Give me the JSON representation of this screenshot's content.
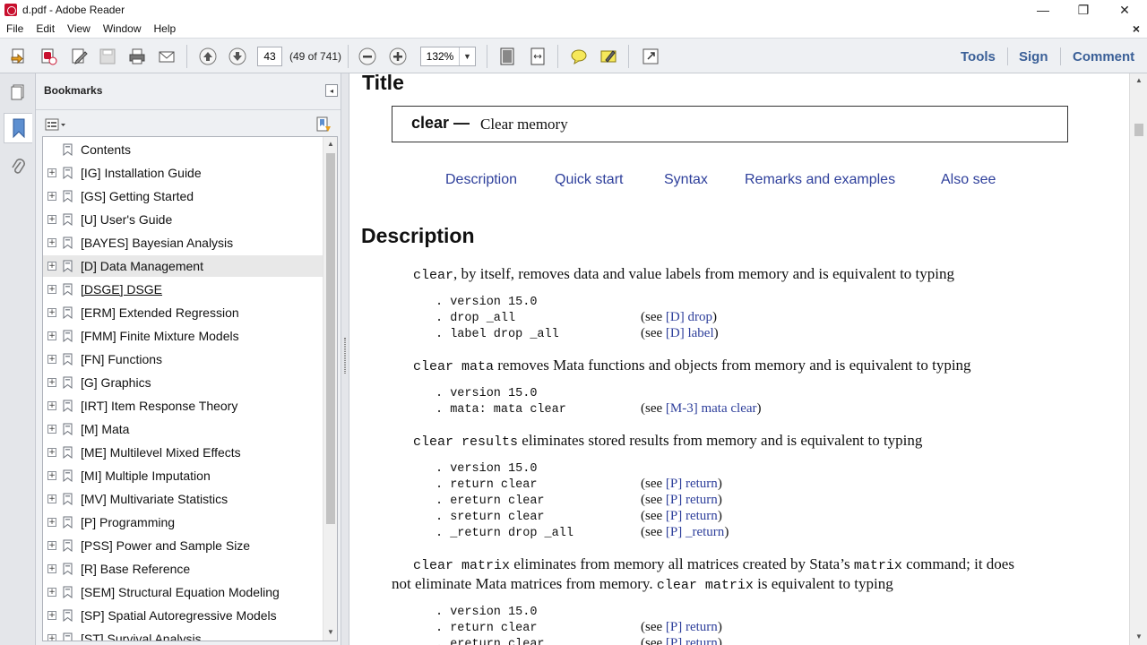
{
  "window": {
    "title": "d.pdf - Adobe Reader",
    "minimize": "—",
    "restore": "❐",
    "close": "✕"
  },
  "menu": {
    "items": [
      "File",
      "Edit",
      "View",
      "Window",
      "Help"
    ],
    "close_doc": "×"
  },
  "toolbar": {
    "page_number": "43",
    "page_count": "(49 of 741)",
    "zoom": "132%",
    "zoom_arrow": "▼",
    "tools": "Tools",
    "sign": "Sign",
    "comment": "Comment"
  },
  "bookmarks": {
    "title": "Bookmarks",
    "collapse_glyph": "◂",
    "items": [
      {
        "label": "Contents",
        "expandable": false
      },
      {
        "label": "[IG] Installation Guide",
        "expandable": true
      },
      {
        "label": "[GS] Getting Started",
        "expandable": true
      },
      {
        "label": "[U] User's Guide",
        "expandable": true
      },
      {
        "label": "[BAYES] Bayesian Analysis",
        "expandable": true
      },
      {
        "label": "[D] Data Management",
        "expandable": true,
        "hover": true
      },
      {
        "label": "[DSGE] DSGE",
        "expandable": true,
        "underline": true
      },
      {
        "label": "[ERM] Extended Regression",
        "expandable": true
      },
      {
        "label": "[FMM] Finite Mixture Models",
        "expandable": true
      },
      {
        "label": "[FN] Functions",
        "expandable": true
      },
      {
        "label": "[G] Graphics",
        "expandable": true
      },
      {
        "label": "[IRT] Item Response Theory",
        "expandable": true
      },
      {
        "label": "[M] Mata",
        "expandable": true
      },
      {
        "label": "[ME] Multilevel Mixed Effects",
        "expandable": true
      },
      {
        "label": "[MI] Multiple Imputation",
        "expandable": true
      },
      {
        "label": "[MV] Multivariate Statistics",
        "expandable": true
      },
      {
        "label": "[P] Programming",
        "expandable": true
      },
      {
        "label": "[PSS] Power and Sample Size",
        "expandable": true
      },
      {
        "label": "[R] Base Reference",
        "expandable": true
      },
      {
        "label": "[SEM] Structural Equation Modeling",
        "expandable": true
      },
      {
        "label": "[SP] Spatial Autoregressive Models",
        "expandable": true
      },
      {
        "label": "[ST] Survival Analysis",
        "expandable": true
      }
    ]
  },
  "document": {
    "heading_title": "Title",
    "title_cmd": "clear —",
    "title_desc": "Clear memory",
    "nav": [
      "Description",
      "Quick start",
      "Syntax",
      "Remarks and examples",
      "Also see"
    ],
    "heading_description": "Description",
    "p1": {
      "cmd": "clear",
      "text": ", by itself, removes data and value labels from memory and is equivalent to typing"
    },
    "code1": [
      ". version 15.0",
      ". drop _all",
      ". label drop _all"
    ],
    "see1": [
      {
        "pre": "(see ",
        "link": "[D] drop",
        "post": ")"
      },
      {
        "pre": "(see ",
        "link": "[D] label",
        "post": ")"
      }
    ],
    "p2": {
      "cmd": "clear mata",
      "text": " removes Mata functions and objects from memory and is equivalent to typing"
    },
    "code2": [
      ". version 15.0",
      ". mata: mata clear"
    ],
    "see2": [
      {
        "pre": "(see ",
        "link": "[M-3] mata clear",
        "post": ")"
      }
    ],
    "p3": {
      "cmd": "clear results",
      "text": " eliminates stored results from memory and is equivalent to typing"
    },
    "code3": [
      ". version 15.0",
      ". return clear",
      ". ereturn clear",
      ". sreturn clear",
      ". _return drop _all"
    ],
    "see3": [
      {
        "pre": "(see ",
        "link": "[P] return",
        "post": ")"
      },
      {
        "pre": "(see ",
        "link": "[P] return",
        "post": ")"
      },
      {
        "pre": "(see ",
        "link": "[P] return",
        "post": ")"
      },
      {
        "pre": "(see ",
        "link": "[P] _return",
        "post": ")"
      }
    ],
    "p4a": {
      "cmd": "clear matrix",
      "text1": " eliminates from memory all matrices created by Stata’s ",
      "cmd2": "matrix",
      "text2": " command; it does"
    },
    "p4b": {
      "text1": "not eliminate Mata matrices from memory. ",
      "cmd": "clear matrix",
      "text2": " is equivalent to typing"
    },
    "code4": [
      ". version 15.0",
      ". return clear",
      ". ereturn clear"
    ],
    "see4": [
      {
        "pre": "(see ",
        "link": "[P] return",
        "post": ")"
      },
      {
        "pre": "(see ",
        "link": "[P] return",
        "post": ")"
      }
    ]
  }
}
